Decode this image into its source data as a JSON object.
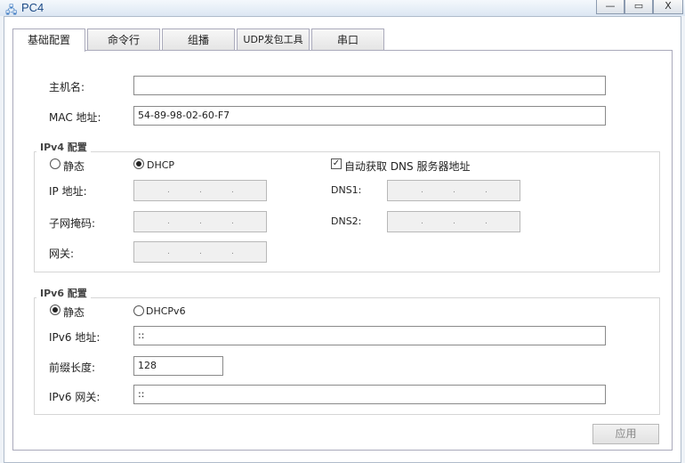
{
  "window": {
    "title": "PC4",
    "minimize": "—",
    "maximize": "▭",
    "close": "X"
  },
  "tabs": [
    "基础配置",
    "命令行",
    "组播",
    "UDP发包工具",
    "串口"
  ],
  "basic": {
    "hostname_label": "主机名:",
    "hostname_value": "",
    "mac_label": "MAC 地址:",
    "mac_value": "54-89-98-02-60-F7"
  },
  "ipv4": {
    "title": "IPv4 配置",
    "static_label": "静态",
    "dhcp_label": "DHCP",
    "mode": "DHCP",
    "auto_dns_label": "自动获取 DNS 服务器地址",
    "auto_dns_checked": true,
    "ip_label": "IP 地址:",
    "mask_label": "子网掩码:",
    "gateway_label": "网关:",
    "dns1_label": "DNS1:",
    "dns2_label": "DNS2:",
    "dot": "."
  },
  "ipv6": {
    "title": "IPv6 配置",
    "static_label": "静态",
    "dhcp_label": "DHCPv6",
    "mode": "静态",
    "ip_label": "IPv6 地址:",
    "ip_value": "::",
    "prefix_label": "前缀长度:",
    "prefix_value": "128",
    "gateway_label": "IPv6 网关:",
    "gateway_value": "::"
  },
  "apply_label": "应用"
}
